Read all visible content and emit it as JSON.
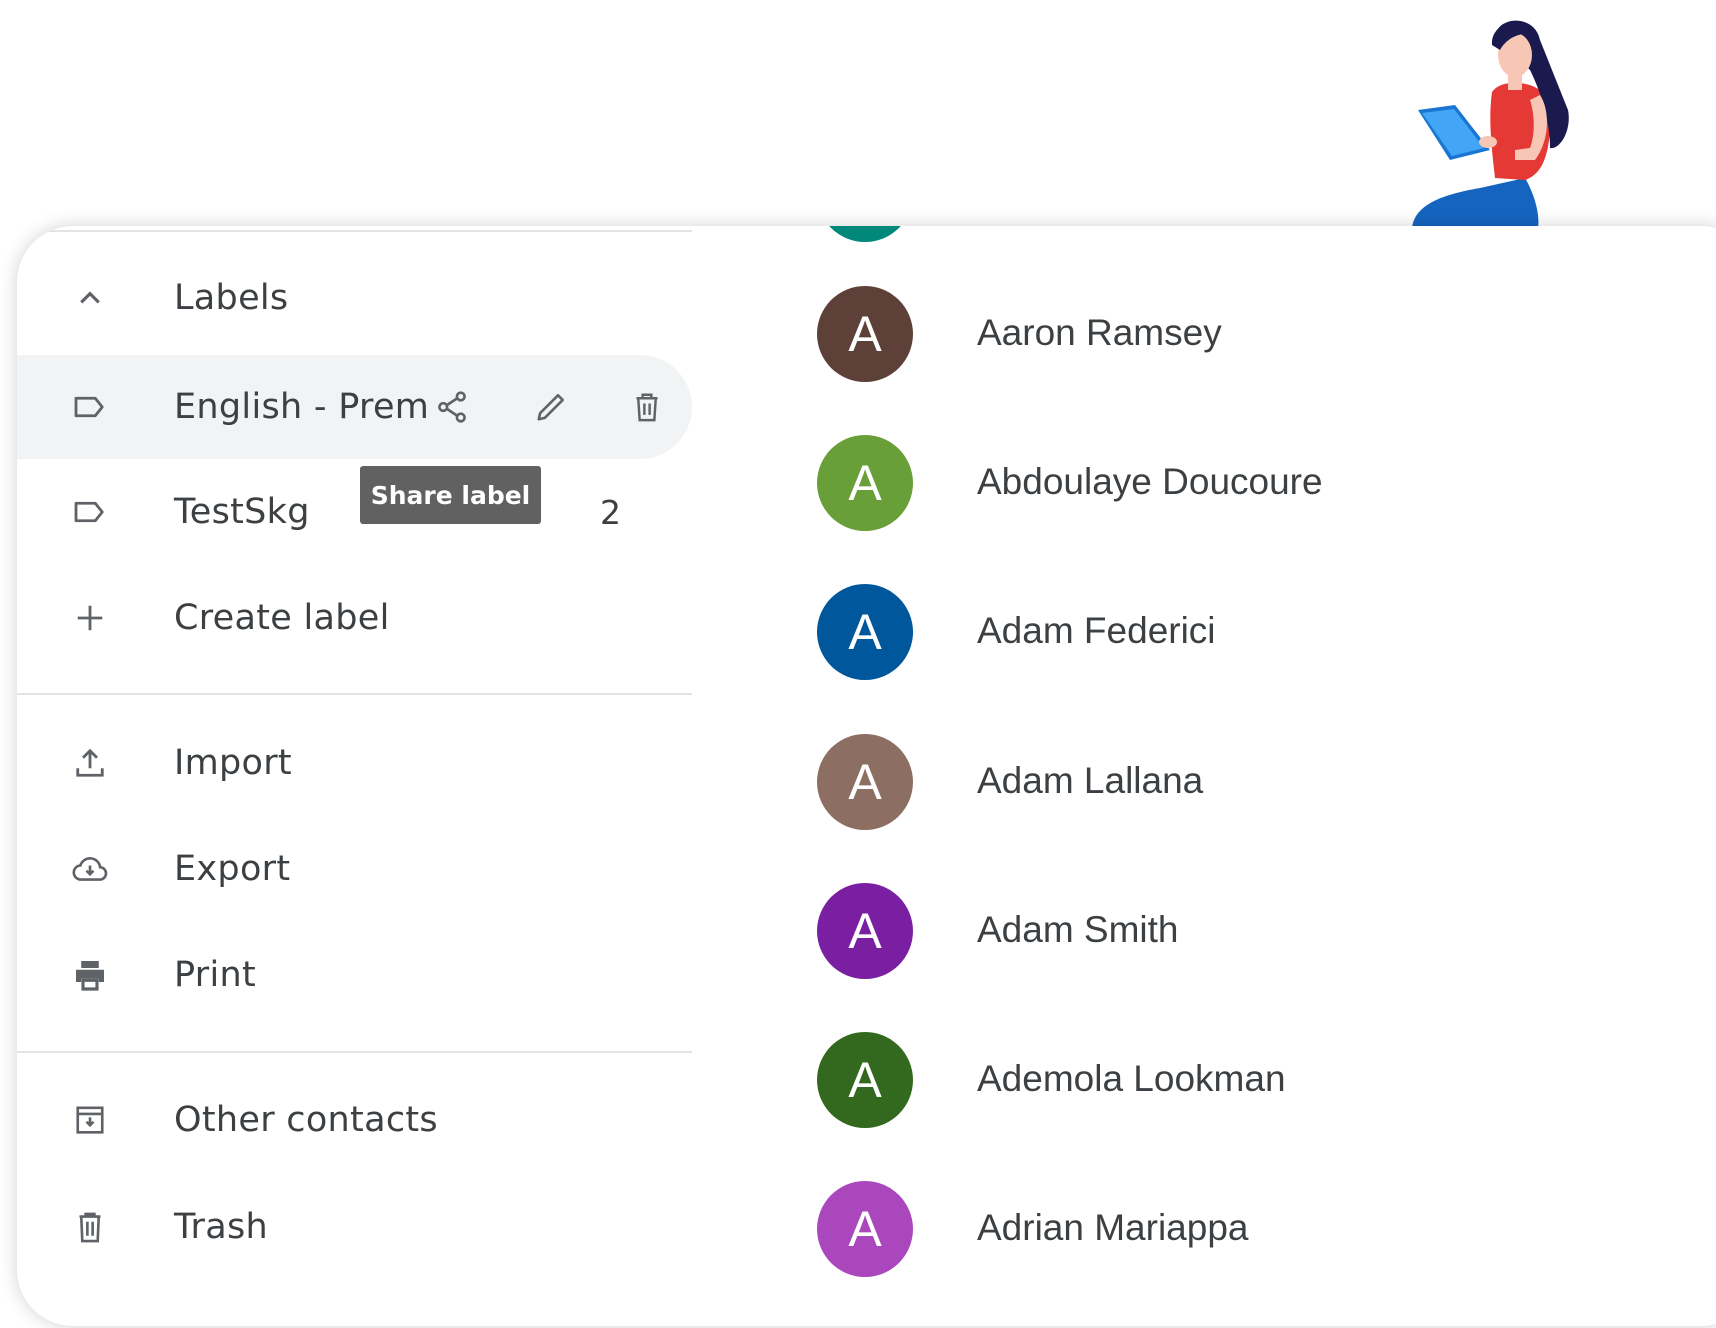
{
  "sidebar": {
    "labels_header": "Labels",
    "labels": [
      {
        "name": "English - Prem",
        "hovered": true
      },
      {
        "name": "TestSkg",
        "count": "2"
      }
    ],
    "create_label": "Create label",
    "tooltip": "Share label",
    "tools": [
      {
        "label": "Import",
        "icon": "upload-icon"
      },
      {
        "label": "Export",
        "icon": "cloud-download-icon"
      },
      {
        "label": "Print",
        "icon": "printer-icon"
      }
    ],
    "bottom": [
      {
        "label": "Other contacts",
        "icon": "archive-download-icon"
      },
      {
        "label": "Trash",
        "icon": "trash-icon"
      }
    ]
  },
  "contacts": [
    {
      "initial": "A",
      "name": "Aaron Ramsey",
      "color": "#5d4037"
    },
    {
      "initial": "A",
      "name": "Abdoulaye Doucoure",
      "color": "#689f38"
    },
    {
      "initial": "A",
      "name": "Adam Federici",
      "color": "#01579b"
    },
    {
      "initial": "A",
      "name": "Adam Lallana",
      "color": "#8d6e63"
    },
    {
      "initial": "A",
      "name": "Adam Smith",
      "color": "#7b1fa2"
    },
    {
      "initial": "A",
      "name": "Ademola Lookman",
      "color": "#33691e"
    },
    {
      "initial": "A",
      "name": "Adrian Mariappa",
      "color": "#ab47bc"
    }
  ],
  "colors": {
    "partial_avatar": "#00897b",
    "hover_bg": "#f1f3f4",
    "text": "#3c4043",
    "icon": "#5f6368"
  }
}
